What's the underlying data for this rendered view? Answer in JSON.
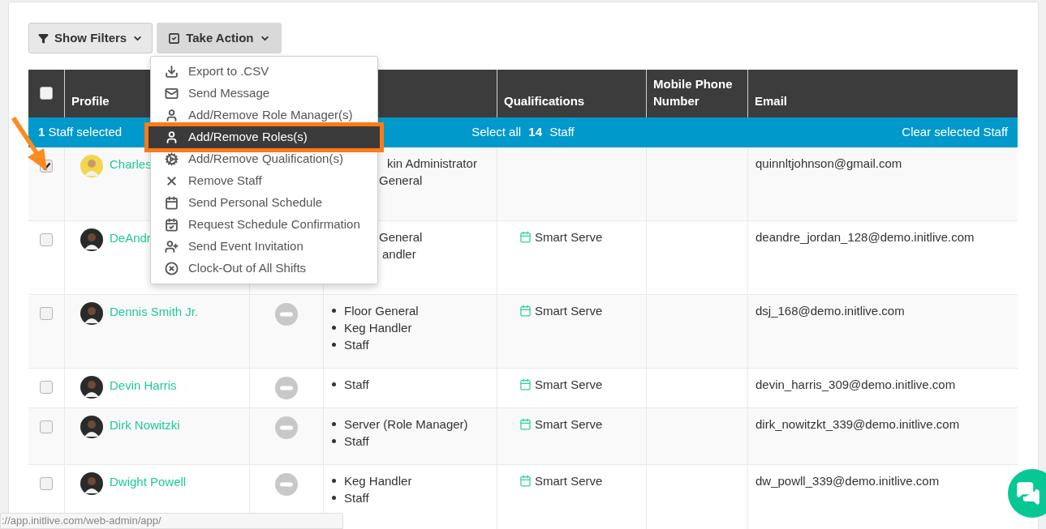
{
  "toolbar": {
    "filters_button": "Show Filters",
    "action_button": "Take Action",
    "action_open": true
  },
  "action_menu": [
    {
      "kind": "download",
      "label": "Export to .CSV",
      "selected": false
    },
    {
      "kind": "mail",
      "label": "Send Message",
      "selected": false
    },
    {
      "kind": "user",
      "label": "Add/Remove Role Manager(s)",
      "selected": false
    },
    {
      "kind": "user",
      "label": "Add/Remove Roles(s)",
      "selected": true
    },
    {
      "kind": "seal",
      "label": "Add/Remove Qualification(s)",
      "selected": false
    },
    {
      "kind": "remove",
      "label": "Remove Staff",
      "selected": false
    },
    {
      "kind": "calendar",
      "label": "Send Personal Schedule",
      "selected": false
    },
    {
      "kind": "calendar-check",
      "label": "Request Schedule Confirmation",
      "selected": false
    },
    {
      "kind": "user-plus",
      "label": "Send Event Invitation",
      "selected": false
    },
    {
      "kind": "circle-x",
      "label": "Clock-Out of All Shifts",
      "selected": false
    }
  ],
  "table": {
    "select_all_checked": false,
    "columns": {
      "profile": "Profile",
      "qualifications": "Qualifications",
      "mobile": "Mobile Phone Number",
      "email": "Email"
    },
    "selection_bar": {
      "selected_text": "**1** Staff selected",
      "select_all": "Select all **14** Staff",
      "clear": "Clear selected Staff"
    },
    "rows": [
      {
        "selected": true,
        "name": "Charles",
        "roles": [
          "kin Administrator",
          "General"
        ],
        "bulleted": false,
        "qualifications": [],
        "email": "quinnltjohnson@gmail.com"
      },
      {
        "selected": false,
        "name": "DeAndr",
        "roles": [
          "General",
          "andler"
        ],
        "bulleted": false,
        "qualifications": [
          "Smart Serve"
        ],
        "email": "deandre_jordan_128@demo.initlive.com"
      },
      {
        "selected": false,
        "name": "Dennis Smith Jr.",
        "inactive": true,
        "roles": [
          "Floor General",
          "Keg Handler",
          "Staff"
        ],
        "bulleted": true,
        "qualifications": [
          "Smart Serve"
        ],
        "email": "dsj_168@demo.initlive.com"
      },
      {
        "selected": false,
        "name": "Devin Harris",
        "inactive": true,
        "roles": [
          "Staff"
        ],
        "bulleted": true,
        "qualifications": [
          "Smart Serve"
        ],
        "email": "devin_harris_309@demo.initlive.com"
      },
      {
        "selected": false,
        "name": "Dirk Nowitzki",
        "inactive": true,
        "roles": [
          "Server (Role Manager)",
          "Staff"
        ],
        "bulleted": true,
        "qualifications": [
          "Smart Serve"
        ],
        "email": "dirk_nowitzkt_339@demo.initlive.com"
      },
      {
        "selected": false,
        "name": "Dwight Powell",
        "inactive": true,
        "roles": [
          "Keg Handler",
          "Staff"
        ],
        "bulleted": true,
        "qualifications": [
          "Smart Serve"
        ],
        "email": "dw_powll_339@demo.initlive.com"
      }
    ]
  },
  "status_bar": {
    "url": "://app.initlive.com/web-admin/app/"
  }
}
